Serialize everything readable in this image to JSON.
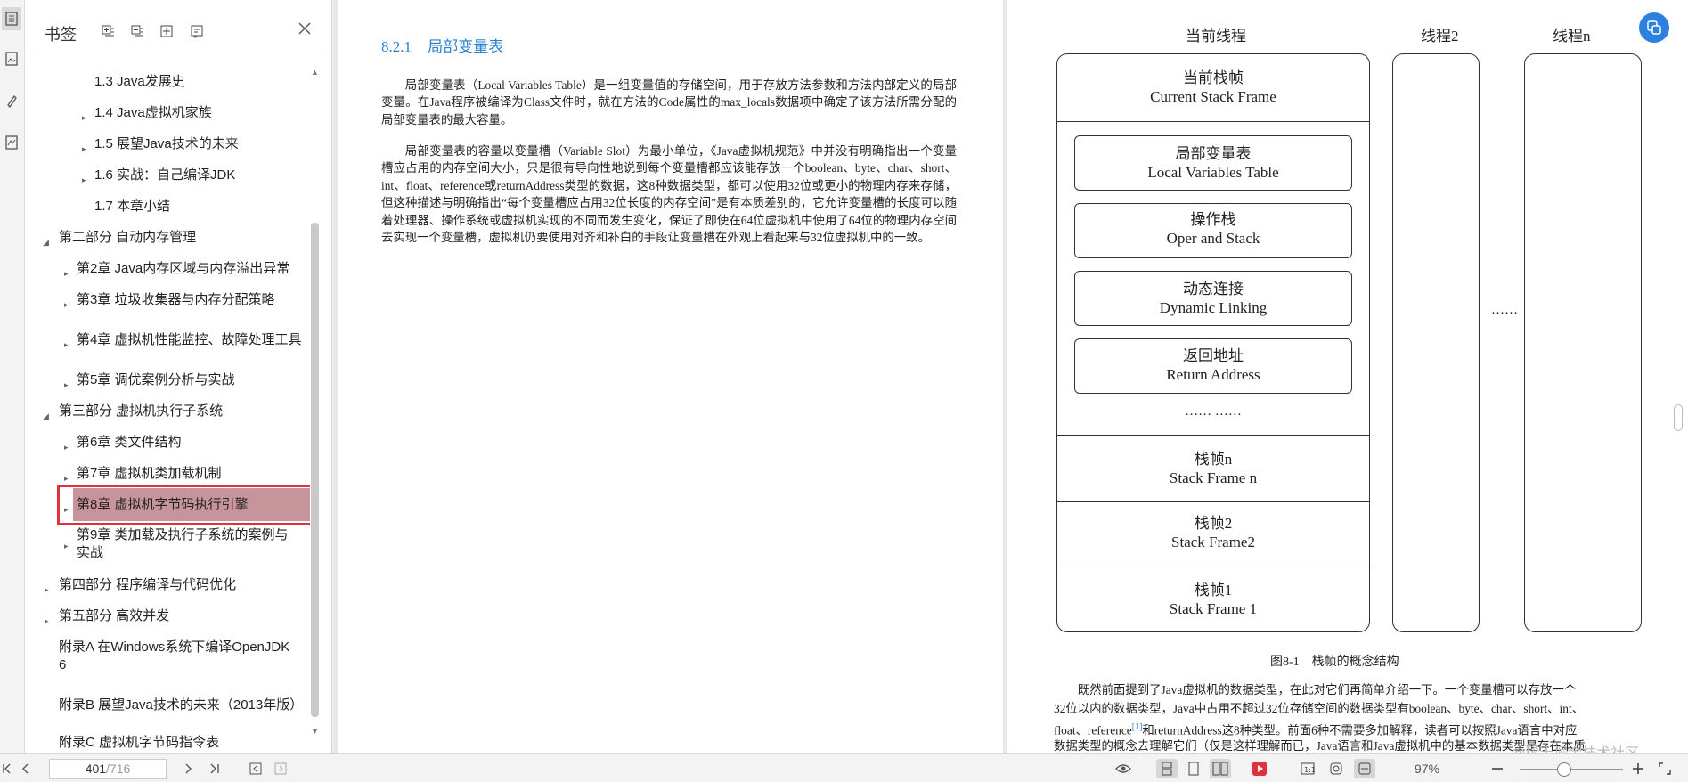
{
  "bookmarks": {
    "title": "书签",
    "items": [
      {
        "label": "1.3 Java发展史",
        "arrow": ""
      },
      {
        "label": "1.4 Java虚拟机家族",
        "arrow": "▸"
      },
      {
        "label": "1.5 展望Java技术的未来",
        "arrow": "▸"
      },
      {
        "label": "1.6 实战：自己编译JDK",
        "arrow": "▸"
      },
      {
        "label": "1.7 本章小结",
        "arrow": ""
      },
      {
        "label": "第二部分 自动内存管理",
        "arrow": "◢"
      },
      {
        "label": "第2章 Java内存区域与内存溢出异常",
        "arrow": "▸"
      },
      {
        "label": "第3章 垃圾收集器与内存分配策略",
        "arrow": "▸"
      },
      {
        "label": "第4章 虚拟机性能监控、故障处理工具",
        "arrow": "▸"
      },
      {
        "label": "第5章 调优案例分析与实战",
        "arrow": "▸"
      },
      {
        "label": "第三部分 虚拟机执行子系统",
        "arrow": "◢"
      },
      {
        "label": "第6章 类文件结构",
        "arrow": "▸"
      },
      {
        "label": "第7章 虚拟机类加载机制",
        "arrow": "▸"
      },
      {
        "label": "第8章 虚拟机字节码执行引擎",
        "arrow": "▸"
      },
      {
        "label": "第9章 类加载及执行子系统的案例与实战",
        "arrow": "▸"
      },
      {
        "label": "第四部分 程序编译与代码优化",
        "arrow": "▸"
      },
      {
        "label": "第五部分 高效并发",
        "arrow": "▸"
      },
      {
        "label": "附录A 在Windows系统下编译OpenJDK 6",
        "arrow": ""
      },
      {
        "label": "附录B 展望Java技术的未来（2013年版）",
        "arrow": ""
      },
      {
        "label": "附录C 虚拟机字节码指令表",
        "arrow": ""
      }
    ]
  },
  "left_page": {
    "section_number": "8.2.1",
    "section_title": "局部变量表",
    "para1": "局部变量表（Local Variables Table）是一组变量值的存储空间，用于存放方法参数和方法内部定义的局部变量。在Java程序被编译为Class文件时，就在方法的Code属性的max_locals数据项中确定了该方法所需分配的局部变量表的最大容量。",
    "para2": "局部变量表的容量以变量槽（Variable Slot）为最小单位，《Java虚拟机规范》中并没有明确指出一个变量槽应占用的内存空间大小，只是很有导向性地说到每个变量槽都应该能存放一个boolean、byte、char、short、int、float、reference或returnAddress类型的数据，这8种数据类型，都可以使用32位或更小的物理内存来存储，但这种描述与明确指出“每个变量槽应占用32位长度的内存空间”是有本质差别的，它允许变量槽的长度可以随着处理器、操作系统或虚拟机实现的不同而发生变化，保证了即使在64位虚拟机中使用了64位的物理内存空间去实现一个变量槽，虚拟机仍要使用对齐和补白的手段让变量槽在外观上看起来与32位虚拟机中的一致。"
  },
  "diagram": {
    "col_current": "当前线程",
    "col_thread2": "线程2",
    "col_threadn": "线程n",
    "current_frame_cn": "当前栈帧",
    "current_frame_en": "Current Stack Frame",
    "lvt_cn": "局部变量表",
    "lvt_en": "Local Variables Table",
    "opstack_cn": "操作栈",
    "opstack_en": "Oper and Stack",
    "dyn_cn": "动态连接",
    "dyn_en": "Dynamic Linking",
    "ret_cn": "返回地址",
    "ret_en": "Return Address",
    "inner_ellipsis": "…… ……",
    "frame_n_cn": "栈帧n",
    "frame_n_en": "Stack Frame n",
    "frame_2_cn": "栈帧2",
    "frame_2_en": "Stack Frame2",
    "frame_1_cn": "栈帧1",
    "frame_1_en": "Stack Frame 1",
    "between_ellipsis": "……",
    "caption": "图8-1　栈帧的概念结构"
  },
  "right_page": {
    "para_line1": "既然前面提到了Java虚拟机的数据类型，在此对它们再简单介绍一下。一个变量槽可以存放一个",
    "para_line2": "32位以内的数据类型，Java中占用不超过32位存储空间的数据类型有boolean、byte、char、short、int、",
    "para_line3a": "float、reference",
    "para_line3sup": "[1]",
    "para_line3b": "和returnAddress这8种类型。前面6种不需要多加解释，读者可以按照Java语言中对应",
    "para_line4": "数据类型的概念去理解它们（仅是这样理解而已，Java语言和Java虚拟机中的基本数据类型是存在本质"
  },
  "status": {
    "page_current": "401",
    "page_total": "/716",
    "zoom": "97%",
    "watermark": "@稀土掘金技术社区"
  },
  "colors": {
    "accent": "#2a7fd1",
    "selection_fill": "#c8949c",
    "selection_border": "#e0323c",
    "play_button": "#e0323c"
  }
}
